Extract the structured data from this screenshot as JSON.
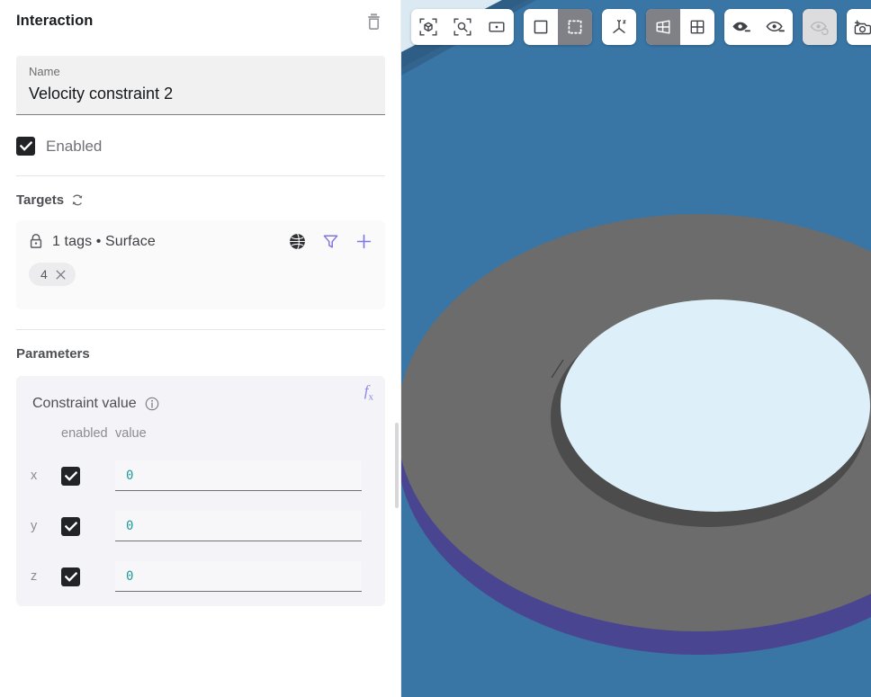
{
  "panel": {
    "title": "Interaction",
    "delete_icon": "trash-icon",
    "name_field": {
      "label": "Name",
      "value": "Velocity constraint 2"
    },
    "enabled": {
      "label": "Enabled",
      "checked": true
    },
    "targets": {
      "section_title": "Targets",
      "refresh_icon": "refresh-icon",
      "lock_icon": "lock-icon",
      "summary": "1 tags • Surface",
      "actions": [
        "globe-icon",
        "filter-icon",
        "plus-icon"
      ],
      "chips": [
        {
          "label": "4",
          "remove_icon": "close-icon"
        }
      ]
    },
    "parameters": {
      "section_title": "Parameters",
      "fx_label": "f",
      "fx_sub": "x",
      "card_title": "Constraint value",
      "info_icon": "info-icon",
      "columns": {
        "axis": "",
        "enabled": "enabled",
        "value": "value"
      },
      "rows": [
        {
          "axis": "x",
          "enabled": true,
          "value": "0"
        },
        {
          "axis": "y",
          "enabled": true,
          "value": "0"
        },
        {
          "axis": "z",
          "enabled": true,
          "value": "0"
        }
      ]
    }
  },
  "viewport": {
    "background_color": "#3a76a5",
    "toolbar": {
      "groups": [
        {
          "name": "zoom-group",
          "buttons": [
            {
              "name": "zoom-fit-object-icon",
              "selected": false,
              "disabled": false
            },
            {
              "name": "zoom-to-selection-icon",
              "selected": false,
              "disabled": false
            },
            {
              "name": "zoom-fit-window-icon",
              "selected": false,
              "disabled": false
            }
          ]
        },
        {
          "name": "selection-mode-group",
          "buttons": [
            {
              "name": "select-rectangle-icon",
              "selected": false,
              "disabled": false
            },
            {
              "name": "select-marquee-icon",
              "selected": true,
              "disabled": false
            }
          ]
        },
        {
          "name": "axes-group",
          "buttons": [
            {
              "name": "axes-gizmo-icon",
              "selected": false,
              "disabled": false
            }
          ]
        },
        {
          "name": "projection-group",
          "buttons": [
            {
              "name": "perspective-view-icon",
              "selected": true,
              "disabled": false
            },
            {
              "name": "orthographic-view-icon",
              "selected": false,
              "disabled": false
            }
          ]
        },
        {
          "name": "visibility-group",
          "buttons": [
            {
              "name": "hide-selected-icon",
              "selected": false,
              "disabled": false
            },
            {
              "name": "show-selected-icon",
              "selected": false,
              "disabled": false
            }
          ]
        },
        {
          "name": "reset-visibility-group",
          "buttons": [
            {
              "name": "reset-visibility-icon",
              "selected": false,
              "disabled": true
            }
          ]
        },
        {
          "name": "camera-group",
          "buttons": [
            {
              "name": "add-camera-icon",
              "selected": false,
              "disabled": false
            }
          ]
        }
      ]
    },
    "model": {
      "description": "annular disc",
      "colors": {
        "background": "#3a76a5",
        "rim": "#4a4590",
        "top_surface": "#6b6b6b",
        "inner_wall": "#4c4c4c",
        "inner_cavity": "#ddeff8",
        "dark_edge": "#2e5d85"
      }
    }
  }
}
